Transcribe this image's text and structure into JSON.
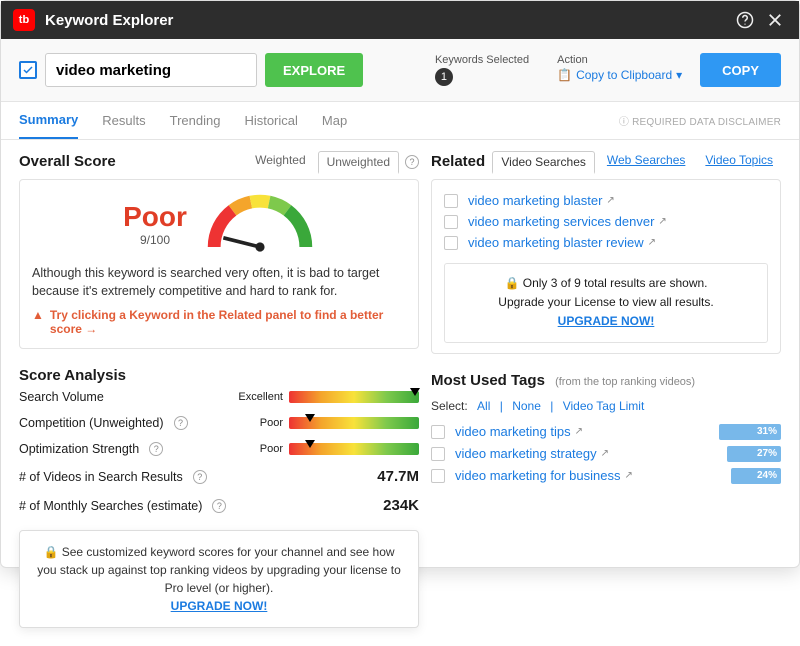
{
  "header": {
    "app_name": "Keyword Explorer"
  },
  "toolbar": {
    "keyword_value": "video marketing",
    "explore_label": "EXPLORE",
    "keywords_selected_label": "Keywords Selected",
    "keywords_selected_count": "1",
    "action_label": "Action",
    "action_link": "Copy to Clipboard",
    "copy_label": "COPY"
  },
  "tabs": {
    "items": [
      "Summary",
      "Results",
      "Trending",
      "Historical",
      "Map"
    ],
    "active": "Summary",
    "disclaimer": "REQUIRED DATA DISCLAIMER"
  },
  "overall_score": {
    "title": "Overall Score",
    "subtabs": [
      "Weighted",
      "Unweighted"
    ],
    "active_subtab": "Unweighted",
    "word": "Poor",
    "numeric": "9/100",
    "description": "Although this keyword is searched very often, it is bad to target because it's extremely competitive and hard to rank for.",
    "tip": "Try clicking a Keyword in the Related panel to find a better score →"
  },
  "score_analysis": {
    "title": "Score Analysis",
    "rows": [
      {
        "label": "Search Volume",
        "rating": "Excellent",
        "marker_pct": 93
      },
      {
        "label": "Competition (Unweighted)",
        "rating": "Poor",
        "marker_pct": 12,
        "help": true
      },
      {
        "label": "Optimization Strength",
        "rating": "Poor",
        "marker_pct": 12,
        "help": true
      },
      {
        "label": "# of Videos in Search Results",
        "value": "47.7M",
        "help": true
      },
      {
        "label": "# of Monthly Searches (estimate)",
        "value": "234K",
        "help": true
      }
    ],
    "popover_text": "See customized keyword scores for your channel and see how you stack up against top ranking videos by upgrading your license to Pro level (or higher).",
    "upgrade_label": "UPGRADE NOW!"
  },
  "related": {
    "title": "Related",
    "tabs": [
      "Video Searches",
      "Web Searches",
      "Video Topics"
    ],
    "active_tab": "Video Searches",
    "items": [
      "video marketing blaster",
      "video marketing services denver",
      "video marketing blaster review"
    ],
    "locked_line1": "Only 3 of 9 total results are shown.",
    "locked_line2": "Upgrade your License to view all results.",
    "upgrade_label": "UPGRADE NOW!"
  },
  "most_used_tags": {
    "title": "Most Used Tags",
    "subtitle": "(from the top ranking videos)",
    "select_label": "Select:",
    "select_all": "All",
    "select_none": "None",
    "select_limit": "Video Tag Limit",
    "items": [
      {
        "text": "video marketing tips",
        "pct": "31%"
      },
      {
        "text": "video marketing strategy",
        "pct": "27%"
      },
      {
        "text": "video marketing for business",
        "pct": "24%"
      }
    ]
  }
}
